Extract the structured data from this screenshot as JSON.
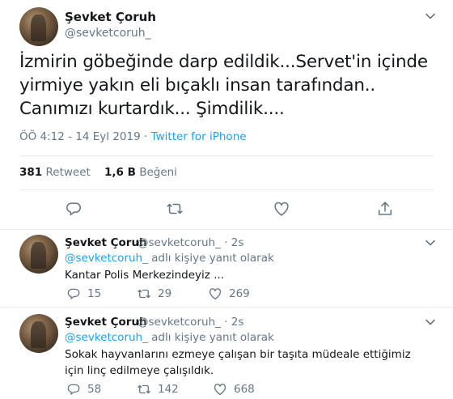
{
  "tweet": {
    "author_name": "Şevket Çoruh",
    "author_handle": "@sevketcoruh_",
    "text": "İzmirin göbeğinde darp edildik...Servet'in içinde yirmiye yakın eli bıçaklı insan tarafından.. Canımızı kurtardık... Şimdilik....",
    "time": "ÖÖ 4:12 - 14 Eyl 2019",
    "separator": "·",
    "source": "Twitter for iPhone",
    "retweet_count": "381",
    "retweet_label": "Retweet",
    "like_count": "1,6 B",
    "like_label": "Beğeni"
  },
  "replies": [
    {
      "author_name": "Şevket Çoruh",
      "author_handle": "@sevketcoruh_",
      "age": "· 2s",
      "reply_mention": "@sevketcoruh_",
      "reply_suffix": " adlı kişiye yanıt olarak",
      "text": "Kantar Polis Merkezindeyiz ...",
      "reply_count": "15",
      "retweet_count": "29",
      "like_count": "269"
    },
    {
      "author_name": "Şevket Çoruh",
      "author_handle": "@sevketcoruh_",
      "age": "· 2s",
      "reply_mention": "@sevketcoruh_",
      "reply_suffix": " adlı kişiye yanıt olarak",
      "text": "Sokak hayvanlarını ezmeye çalışan bir taşıta müdeale ettiğimiz için  linç edilmeye çalışıldık.",
      "reply_count": "58",
      "retweet_count": "142",
      "like_count": "668"
    }
  ],
  "colors": {
    "link": "#1da1f2",
    "muted": "#657786",
    "text": "#14171a",
    "divider": "#e6ecf0"
  },
  "icons": [
    "caret-down-icon",
    "reply-icon",
    "retweet-icon",
    "like-icon",
    "share-icon"
  ]
}
